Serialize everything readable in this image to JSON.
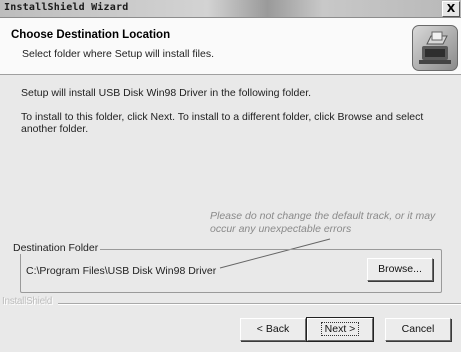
{
  "window": {
    "title": "InstallShield Wizard",
    "close_glyph": "X"
  },
  "header": {
    "title": "Choose Destination Location",
    "subtitle": "Select folder where Setup will install files.",
    "icon": "computer-install-icon"
  },
  "body": {
    "line1": "Setup will install USB Disk Win98 Driver in the following folder.",
    "line2": "To install to this folder, click Next. To install to a different folder, click Browse and select",
    "line3": "another folder."
  },
  "annotation": {
    "line1": "Please do not change the default track, or it may",
    "line2": "occur any unexpectable errors"
  },
  "destination": {
    "group_label": "Destination Folder",
    "path": "C:\\Program Files\\USB Disk Win98 Driver",
    "browse_label": "Browse..."
  },
  "footer": {
    "brand": "InstallShield",
    "back_label": "< Back",
    "next_label": "Next >",
    "cancel_label": "Cancel"
  }
}
